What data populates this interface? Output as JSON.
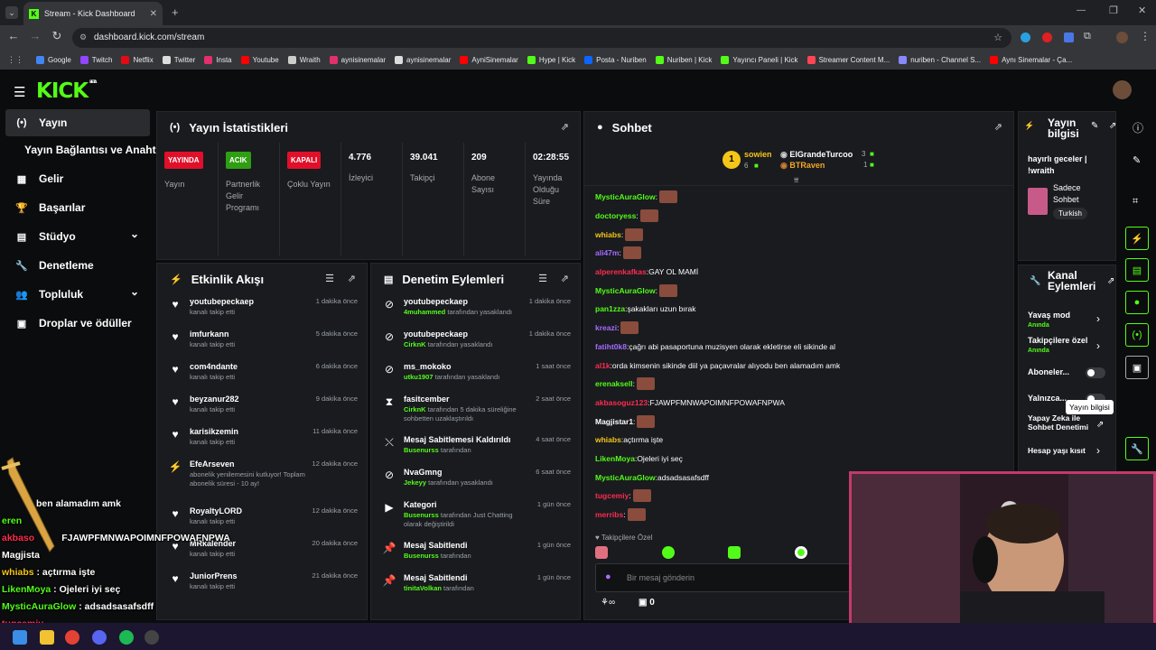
{
  "browser": {
    "tab_title": "Stream - Kick Dashboard",
    "url": "dashboard.kick.com/stream",
    "bookmarks": [
      {
        "label": "Google",
        "color": "#4285f4"
      },
      {
        "label": "Twitch",
        "color": "#9146ff"
      },
      {
        "label": "Netflix",
        "color": "#e50914"
      },
      {
        "label": "Twitter",
        "color": "#dddddd"
      },
      {
        "label": "Insta",
        "color": "#e1306c"
      },
      {
        "label": "Youtube",
        "color": "#ff0000"
      },
      {
        "label": "Wraith",
        "color": "#cccccc"
      },
      {
        "label": "aynisinemalar",
        "color": "#e1306c"
      },
      {
        "label": "aynisinemalar",
        "color": "#dddddd"
      },
      {
        "label": "AyniSinemalar",
        "color": "#ff0000"
      },
      {
        "label": "Hype | Kick",
        "color": "#53fc18"
      },
      {
        "label": "Posta - Nuriben",
        "color": "#0a66ff"
      },
      {
        "label": "Nuriben | Kick",
        "color": "#53fc18"
      },
      {
        "label": "Yayıncı Paneli | Kick",
        "color": "#53fc18"
      },
      {
        "label": "Streamer Content M...",
        "color": "#ff4455"
      },
      {
        "label": "nuriben - Channel S...",
        "color": "#8888ff"
      },
      {
        "label": "Aynı Sinemalar - Ça...",
        "color": "#ff0000"
      }
    ]
  },
  "header": {
    "logo": "KICK",
    "beta": "BETA"
  },
  "sidebar": {
    "items": [
      {
        "label": "Yayın",
        "icon": "broadcast-icon",
        "glyph": "(•)"
      },
      {
        "label": "Yayın Bağlantısı ve Anahtarı",
        "icon": "none",
        "glyph": ""
      },
      {
        "label": "Gelir",
        "icon": "revenue-icon",
        "glyph": "▦"
      },
      {
        "label": "Başarılar",
        "icon": "trophy-icon",
        "glyph": "🏆"
      },
      {
        "label": "Stüdyo",
        "icon": "studio-icon",
        "glyph": "▤"
      },
      {
        "label": "Denetleme",
        "icon": "wrench-icon",
        "glyph": "🔧"
      },
      {
        "label": "Topluluk",
        "icon": "community-icon",
        "glyph": "👥"
      },
      {
        "label": "Droplar ve ödüller",
        "icon": "gift-icon",
        "glyph": "▣"
      }
    ]
  },
  "stats": {
    "title": "Yayın İstatistikleri",
    "cells": [
      {
        "badge": "YAYINDA",
        "badge_color": "#e0102a",
        "label": "Yayın"
      },
      {
        "badge": "ACIK",
        "badge_color": "#2f9e14",
        "label": "Partnerlik Gelir Programı"
      },
      {
        "badge": "KAPALI",
        "badge_color": "#e0102a",
        "label": "Çoklu Yayın"
      },
      {
        "value": "4.776",
        "label": "İzleyici"
      },
      {
        "value": "39.041",
        "label": "Takipçi"
      },
      {
        "value": "209",
        "label": "Abone Sayısı"
      },
      {
        "value": "02:28:55",
        "label": "Yayında Olduğu Süre"
      }
    ]
  },
  "activity": {
    "title": "Etkinlik Akışı",
    "rows": [
      {
        "name": "youtubepeckaep",
        "sub": "kanalı takip etti",
        "time": "1 dakika önce"
      },
      {
        "name": "imfurkann",
        "sub": "kanalı takip etti",
        "time": "5 dakika önce"
      },
      {
        "name": "com4ndante",
        "sub": "kanalı takip etti",
        "time": "6 dakika önce"
      },
      {
        "name": "beyzanur282",
        "sub": "kanalı takip etti",
        "time": "9 dakika önce"
      },
      {
        "name": "karisikzemin",
        "sub": "kanalı takip etti",
        "time": "11 dakika önce"
      },
      {
        "name": "EfeArseven",
        "sub": "abonelik yenilemesini kutluyor! Toplam abonelik süresi - 10 ay!",
        "time": "12 dakika önce"
      },
      {
        "name": "RoyaltyLORD",
        "sub": "kanalı takip etti",
        "time": "12 dakika önce"
      },
      {
        "name": "MRkalender",
        "sub": "kanalı takip etti",
        "time": "20 dakika önce"
      },
      {
        "name": "JuniorPrens",
        "sub": "kanalı takip etti",
        "time": "21 dakika önce"
      }
    ]
  },
  "moderation": {
    "title": "Denetim Eylemleri",
    "rows": [
      {
        "name": "youtubepeckaep",
        "actor": "4muhammed",
        "sub": "tarafından yasaklandı",
        "time": "1 dakika önce",
        "icon": "ban-icon",
        "glyph": "⊘"
      },
      {
        "name": "youtubepeckaep",
        "actor": "CirknK",
        "sub": "tarafından yasaklandı",
        "time": "1 dakika önce",
        "icon": "ban-icon",
        "glyph": "⊘"
      },
      {
        "name": "ms_mokoko",
        "actor": "utku1907",
        "sub": "tarafından yasaklandı",
        "time": "1 saat önce",
        "icon": "ban-icon",
        "glyph": "⊘"
      },
      {
        "name": "fasitcember",
        "actor": "CirknK",
        "sub": "tarafından 5 dakika süreliğine sohbetten uzaklaştırıldı",
        "time": "2 saat önce",
        "icon": "hourglass-icon",
        "glyph": "⧗"
      },
      {
        "name": "Mesaj Sabitlemesi Kaldırıldı",
        "actor": "Busenurss",
        "sub": "tarafından",
        "time": "4 saat önce",
        "icon": "unpin-icon",
        "glyph": "⤬"
      },
      {
        "name": "NvaGmng",
        "actor": "Jekeyy",
        "sub": "tarafından yasaklandı",
        "time": "6 saat önce",
        "icon": "ban-icon",
        "glyph": "⊘"
      },
      {
        "name": "Kategori",
        "actor": "Busenurss",
        "sub": "tarafından Just Chatting olarak değiştirildi",
        "time": "1 gün önce",
        "icon": "category-icon",
        "glyph": "▶"
      },
      {
        "name": "Mesaj Sabitlendi",
        "actor": "Busenurss",
        "sub": "tarafından",
        "time": "1 gün önce",
        "icon": "pin-icon",
        "glyph": "📌"
      },
      {
        "name": "Mesaj Sabitlendi",
        "actor": "tinitaVolkan",
        "sub": "tarafından",
        "time": "1 gün önce",
        "icon": "pin-icon",
        "glyph": "📌"
      }
    ]
  },
  "chat": {
    "title": "Sohbet",
    "leader1": {
      "name": "sowien",
      "count": "6",
      "rank": "1"
    },
    "leader2": {
      "name": "ElGrandeTurcoo",
      "count": "3"
    },
    "leader3": {
      "name": "BTRaven",
      "count": "1"
    },
    "messages": [
      {
        "user": "MysticAuraGlow",
        "color": "#53fc18",
        "text": "",
        "emote": true
      },
      {
        "user": "doctoryess",
        "color": "#53fc18",
        "text": "",
        "emote": true
      },
      {
        "user": "whiabs",
        "color": "#f5c518",
        "text": "",
        "emote": true
      },
      {
        "user": "ali47m",
        "color": "#a66bff",
        "text": "",
        "emote": true
      },
      {
        "user": "alperenkafkas",
        "color": "#ff2b4f",
        "text": "GAY OL MAMİ",
        "emote": false
      },
      {
        "user": "MysticAuraGlow",
        "color": "#53fc18",
        "text": "",
        "emote": true
      },
      {
        "user": "pan1zza",
        "color": "#53fc18",
        "text": "şakakları uzun bırak",
        "emote": false
      },
      {
        "user": "kreazi",
        "color": "#a66bff",
        "text": "",
        "emote": true
      },
      {
        "user": "fatiht0k8",
        "color": "#a66bff",
        "text": "çağrı abi pasaportuna muzisyen olarak ekletirse eli sikinde al",
        "emote": false
      },
      {
        "user": "al1k",
        "color": "#ff2b4f",
        "text": "orda kimsenin sikinde diil ya paçavralar alıyodu ben alamadım amk",
        "emote": false
      },
      {
        "user": "erenaksell",
        "color": "#53fc18",
        "text": "",
        "emote": true
      },
      {
        "user": "akbasoguz123",
        "color": "#ff2b4f",
        "text": "FJAWPFMNWAPOIMNFPOWAFNPWA",
        "emote": false
      },
      {
        "user": "Magjistar1",
        "color": "#ffffff",
        "text": "",
        "emote": true
      },
      {
        "user": "whiabs",
        "color": "#f5c518",
        "text": "açtırma işte",
        "emote": false
      },
      {
        "user": "LikenMoya",
        "color": "#53fc18",
        "text": "Ojeleri iyi seç",
        "emote": false
      },
      {
        "user": "MysticAuraGlow",
        "color": "#53fc18",
        "text": "adsadsasafsdff",
        "emote": false
      },
      {
        "user": "tugcemiy",
        "color": "#ff2b4f",
        "text": "",
        "emote": true
      },
      {
        "user": "merribs",
        "color": "#ff2b4f",
        "text": "",
        "emote": true
      }
    ],
    "followers_only": "Takipçilere Özel",
    "input_placeholder": "Bir mesaj gönderin",
    "count_zero": "0"
  },
  "stream_info": {
    "title": "Yayın bilgisi",
    "stream_title": "hayırlı geceler | !wraith",
    "category": "Sadece Sohbet",
    "language": "Turkish"
  },
  "channel_actions": {
    "title": "Kanal Eylemleri",
    "slow_mode": "Yavaş mod",
    "slow_mode_sub": "Anında",
    "followers_only": "Takipçilere özel",
    "followers_only_sub": "Anında",
    "subscribers": "Aboneler...",
    "emotes": "Yalnızca...",
    "ai_mod": "Yapay Zeka ile Sohbet Denetimi",
    "age_limit": "Hesap yaşı kısıt",
    "tooltip": "Yayın bilgisi"
  },
  "overlay_chat": [
    {
      "user": "",
      "text": "ben alamadım amk",
      "color": "#ffffff"
    },
    {
      "user": "eren",
      "text": "",
      "color": "#53fc18"
    },
    {
      "user": "akbaso",
      "text": "FJAWPFMNWAPOIMNFPOWAFNPWA",
      "color": "#ff2b4f"
    },
    {
      "user": "Magjista",
      "text": "",
      "color": "#ffffff"
    },
    {
      "user": "whiabs",
      "text": " : açtırma işte",
      "color": "#f5c518"
    },
    {
      "user": "LikenMoya",
      "text": " : Ojeleri iyi seç",
      "color": "#53fc18"
    },
    {
      "user": "MysticAuraGlow",
      "text": " : adsadsasafsdff",
      "color": "#53fc18"
    },
    {
      "user": "tugcemiy",
      "text": "",
      "color": "#ff2b4f"
    }
  ]
}
